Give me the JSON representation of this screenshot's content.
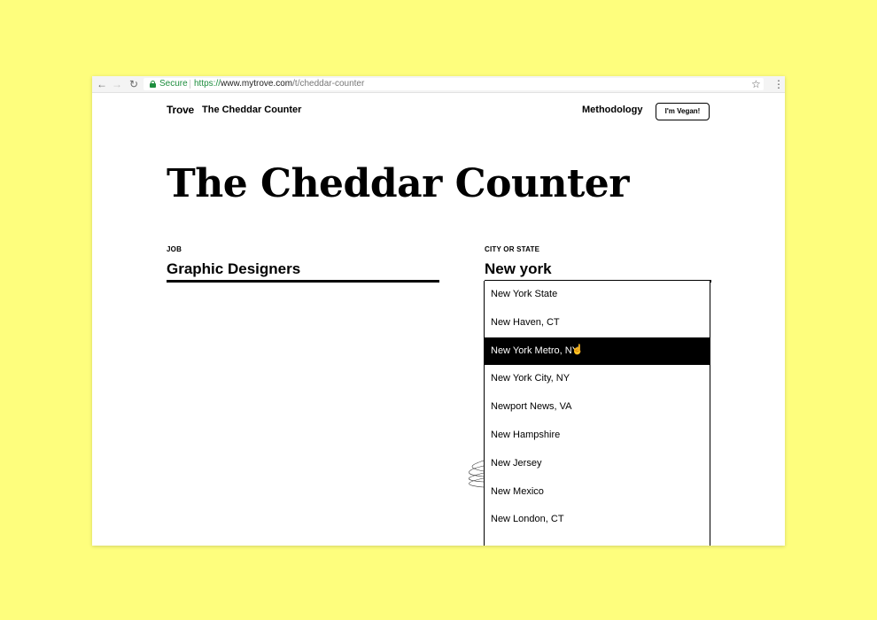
{
  "browser": {
    "secure_label": "Secure",
    "url_scheme": "https://",
    "url_host": "www.mytrove.com",
    "url_path": "/t/cheddar-counter"
  },
  "header": {
    "logo": "Trove",
    "site_title": "The Cheddar Counter",
    "methodology": "Methodology",
    "vegan_button": "I'm Vegan!"
  },
  "page_title": "The Cheddar Counter",
  "job": {
    "label": "JOB",
    "value": "Graphic Designers"
  },
  "city": {
    "label": "CITY OR STATE",
    "value": "New york"
  },
  "dropdown": {
    "items": [
      "New York State",
      "New Haven, CT",
      "New York Metro, NY",
      "New York City, NY",
      "Newport News, VA",
      "New Hampshire",
      "New Jersey",
      "New Mexico",
      "New London, CT"
    ],
    "highlighted_index": 2
  },
  "colors": {
    "background": "#fefe7d",
    "secure": "#1e8e3e",
    "highlight": "#000000"
  }
}
